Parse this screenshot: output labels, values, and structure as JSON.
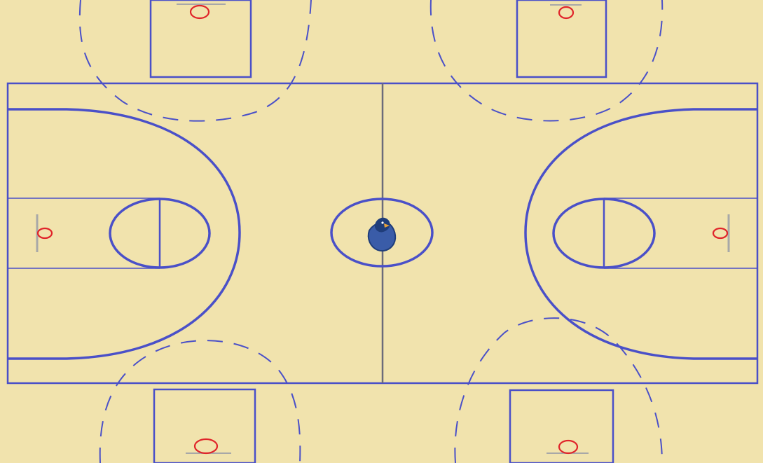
{
  "court": {
    "floor_color": "#f1e3ad",
    "line_color": "#4a50c8",
    "center_line_color": "#6b6b7a",
    "rim_color": "#e0242a",
    "backboard_color": "#a8a8a8",
    "logo_icon": "eagle-mascot-icon",
    "logo_colors": {
      "primary": "#1f3d7a",
      "secondary": "#3a5ca8",
      "beak": "#e8a23a"
    }
  },
  "side_courts": {
    "count": 4,
    "positions": [
      "top-left",
      "top-right",
      "bottom-left",
      "bottom-right"
    ],
    "line_style": "dashed"
  }
}
